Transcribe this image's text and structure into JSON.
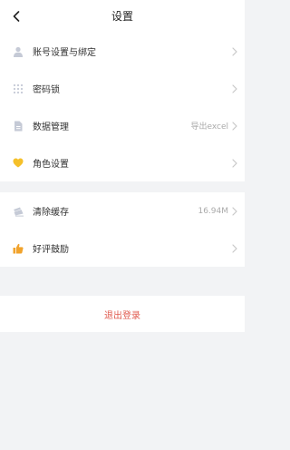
{
  "header": {
    "title": "设置",
    "back_icon": "chevron-left-icon"
  },
  "settings": {
    "account": {
      "label": "账号设置与绑定",
      "icon": "user-icon"
    },
    "password_lock": {
      "label": "密码锁",
      "icon": "keypad-icon"
    },
    "data_management": {
      "label": "数据管理",
      "value": "导出excel",
      "icon": "document-icon"
    },
    "role": {
      "label": "角色设置",
      "icon": "heart-icon"
    }
  },
  "storage": {
    "clear_cache": {
      "label": "清除缓存",
      "value": "16.94M",
      "icon": "broom-icon"
    },
    "rate": {
      "label": "好评鼓励",
      "icon": "thumbs-up-icon"
    }
  },
  "logout": {
    "label": "退出登录"
  },
  "colors": {
    "background": "#f2f3f5",
    "icon_gray": "#c5cad6",
    "heart_yellow": "#f5c02a",
    "thumb_orange": "#f1a32c",
    "logout_red": "#e05a4e"
  }
}
